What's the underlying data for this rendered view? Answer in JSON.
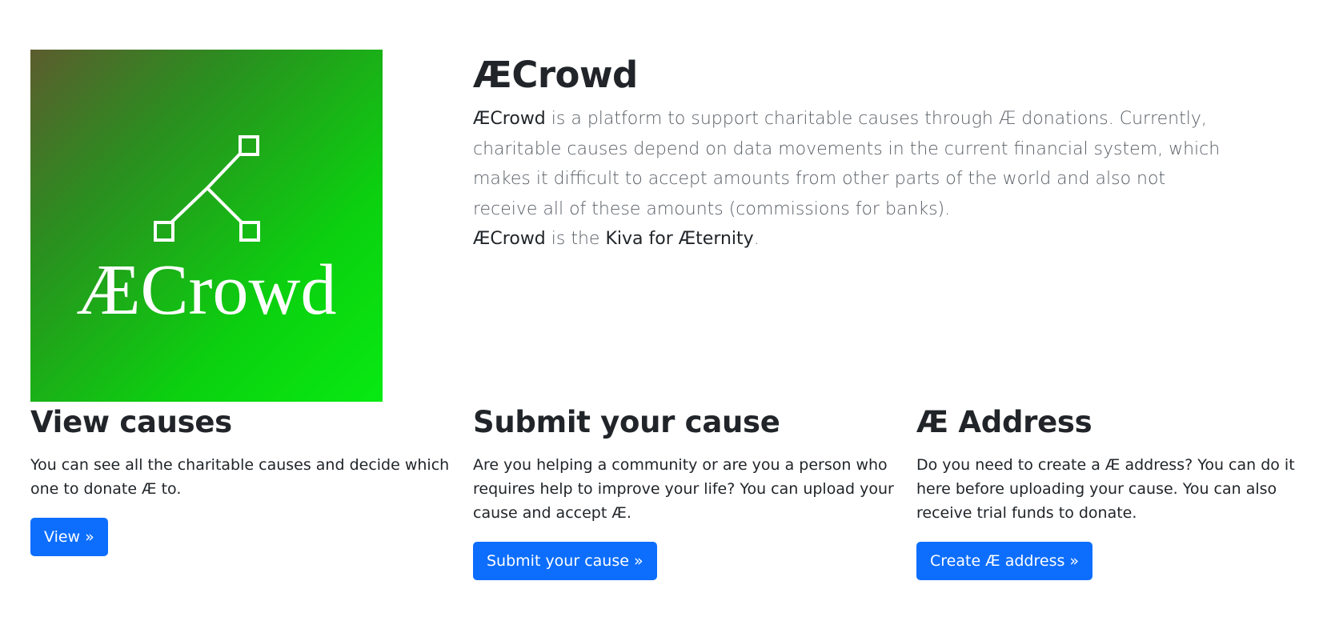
{
  "logo": {
    "text": "ÆCrowd",
    "icon": "network-nodes-icon",
    "gradient": [
      "#5c5c2e",
      "#0bd10f"
    ]
  },
  "hero": {
    "title": "ÆCrowd",
    "p1_brand": "ÆCrowd",
    "p1_text": " is a platform to support charitable causes through Æ donations. Currently, charitable causes depend on data movements in the current financial system, which makes it difficult to accept amounts from other parts of the world and also not receive all of these amounts (commissions for banks).",
    "p2_brand": "ÆCrowd",
    "p2_mid": " is the ",
    "p2_highlight": "Kiva for Æternity",
    "p2_end": "."
  },
  "columns": [
    {
      "title": "View causes",
      "text": "You can see all the charitable causes and decide which one to donate Æ to.",
      "button": "View »"
    },
    {
      "title": "Submit your cause",
      "text": "Are you helping a community or are you a person who requires help to improve your life? You can upload your cause and accept Æ.",
      "button": "Submit your cause »"
    },
    {
      "title": "Æ Address",
      "text": "Do you need to create a Æ address? You can do it here before uploading your cause. You can also receive trial funds to donate.",
      "button": "Create Æ address »"
    }
  ],
  "colors": {
    "primary": "#0d6efd",
    "text": "#212529",
    "muted": "#585e65"
  }
}
